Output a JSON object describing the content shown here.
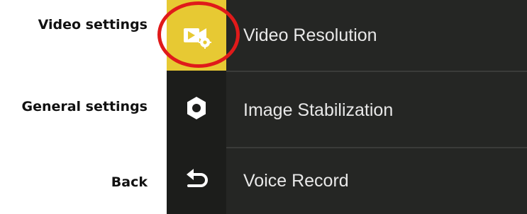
{
  "callouts": {
    "video": "Video settings",
    "general": "General settings",
    "back": "Back"
  },
  "rail": [
    {
      "icon": "video-settings-icon",
      "active": true
    },
    {
      "icon": "gear-icon",
      "active": false
    },
    {
      "icon": "back-arrow-icon",
      "active": false
    }
  ],
  "menu": {
    "items": [
      {
        "label": "Video Resolution"
      },
      {
        "label": "Image Stabilization"
      },
      {
        "label": "Voice Record"
      }
    ]
  },
  "colors": {
    "accent": "#e7c933",
    "highlight_ring": "#e01a1a",
    "screen_bg": "#252624"
  }
}
